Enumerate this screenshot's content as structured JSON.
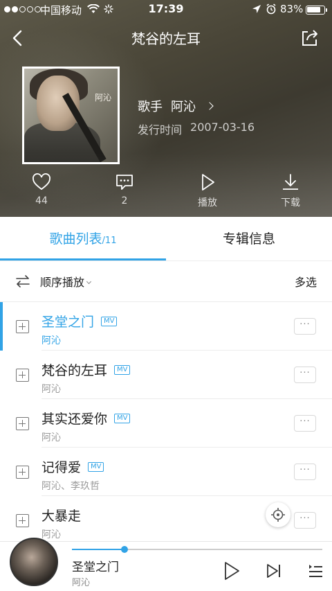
{
  "status_bar": {
    "carrier": "中国移动",
    "time": "17:39",
    "battery": "83%",
    "battery_level": 0.83,
    "signal_bars_filled": 2,
    "signal_bars_total": 5
  },
  "header": {
    "title": "梵谷的左耳",
    "cover_text": "阿沁"
  },
  "album": {
    "artist_label": "歌手",
    "artist": "阿沁",
    "release_label": "发行时间",
    "release_date": "2007-03-16"
  },
  "actions": {
    "like_count": "44",
    "comment_count": "2",
    "play_label": "播放",
    "download_label": "下载"
  },
  "tabs": {
    "songs_label": "歌曲列表",
    "songs_count": "/11",
    "album_info_label": "专辑信息"
  },
  "toolbar": {
    "order_label": "顺序播放",
    "multi_select_label": "多选"
  },
  "songs": [
    {
      "title": "圣堂之门",
      "artist": "阿沁",
      "mv": "MV",
      "active": true
    },
    {
      "title": "梵谷的左耳",
      "artist": "阿沁",
      "mv": "MV",
      "active": false
    },
    {
      "title": "其实还爱你",
      "artist": "阿沁",
      "mv": "MV",
      "active": false
    },
    {
      "title": "记得爱",
      "artist": "阿沁、李玖哲",
      "mv": "MV",
      "active": false
    },
    {
      "title": "大暴走",
      "artist": "阿沁",
      "mv": "",
      "active": false
    }
  ],
  "more_label": "···",
  "player": {
    "title": "圣堂之门",
    "artist": "阿沁",
    "progress": 0.21
  },
  "colors": {
    "accent": "#31a3e6",
    "text_primary": "#222222",
    "text_secondary": "#999999"
  },
  "icons": {
    "back": "back-icon",
    "share": "share-icon",
    "like": "heart-icon",
    "comment": "comment-icon",
    "play": "play-icon",
    "download": "download-icon",
    "order": "sequence-icon",
    "add": "add-icon",
    "locate": "locate-icon",
    "next": "next-icon",
    "playlist": "playlist-icon"
  }
}
